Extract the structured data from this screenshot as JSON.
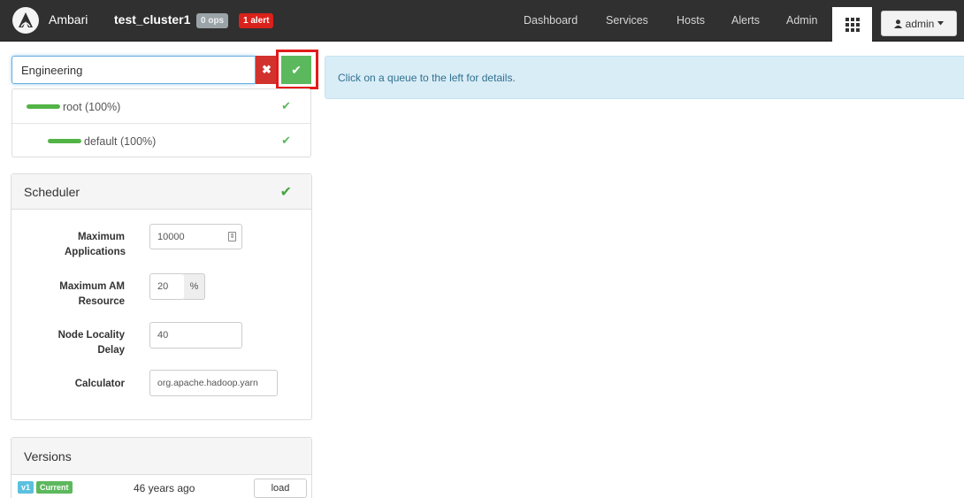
{
  "navbar": {
    "brand": "Ambari",
    "cluster_name": "test_cluster1",
    "ops_badge": "0 ops",
    "alert_badge": "1 alert",
    "links": [
      "Dashboard",
      "Services",
      "Hosts",
      "Alerts",
      "Admin"
    ],
    "user_menu": "admin",
    "icons": {
      "logo": "ambari-logo-icon",
      "apps": "grid-icon",
      "user": "user-icon",
      "caret": "caret-down-icon"
    }
  },
  "queue_search": {
    "value": "Engineering",
    "clear_icon": "✖",
    "save_icon": "✔"
  },
  "queues": [
    {
      "label": "root (100%)",
      "status_icon": "✔"
    },
    {
      "label": "default (100%)",
      "status_icon": "✔"
    }
  ],
  "scheduler": {
    "title": "Scheduler",
    "status_icon": "✔",
    "fields": {
      "max_apps_label": "Maximum Applications",
      "max_apps_value": "10000",
      "max_am_label": "Maximum AM Resource",
      "max_am_value": "20",
      "max_am_unit": "%",
      "locality_label": "Node Locality Delay",
      "locality_value": "40",
      "calculator_label": "Calculator",
      "calculator_value": "org.apache.hadoop.yarn"
    }
  },
  "versions": {
    "title": "Versions",
    "items": [
      {
        "version": "v1",
        "status": "Current",
        "time": "46 years ago",
        "action": "load"
      }
    ]
  },
  "info": {
    "message": "Click on a queue to the left for details."
  },
  "colors": {
    "navbar": "#303030",
    "success": "#5cb85c",
    "danger": "#d2322d",
    "info_bg": "#d9edf7",
    "info_text": "#31708f",
    "highlight": "#e31b1b"
  }
}
